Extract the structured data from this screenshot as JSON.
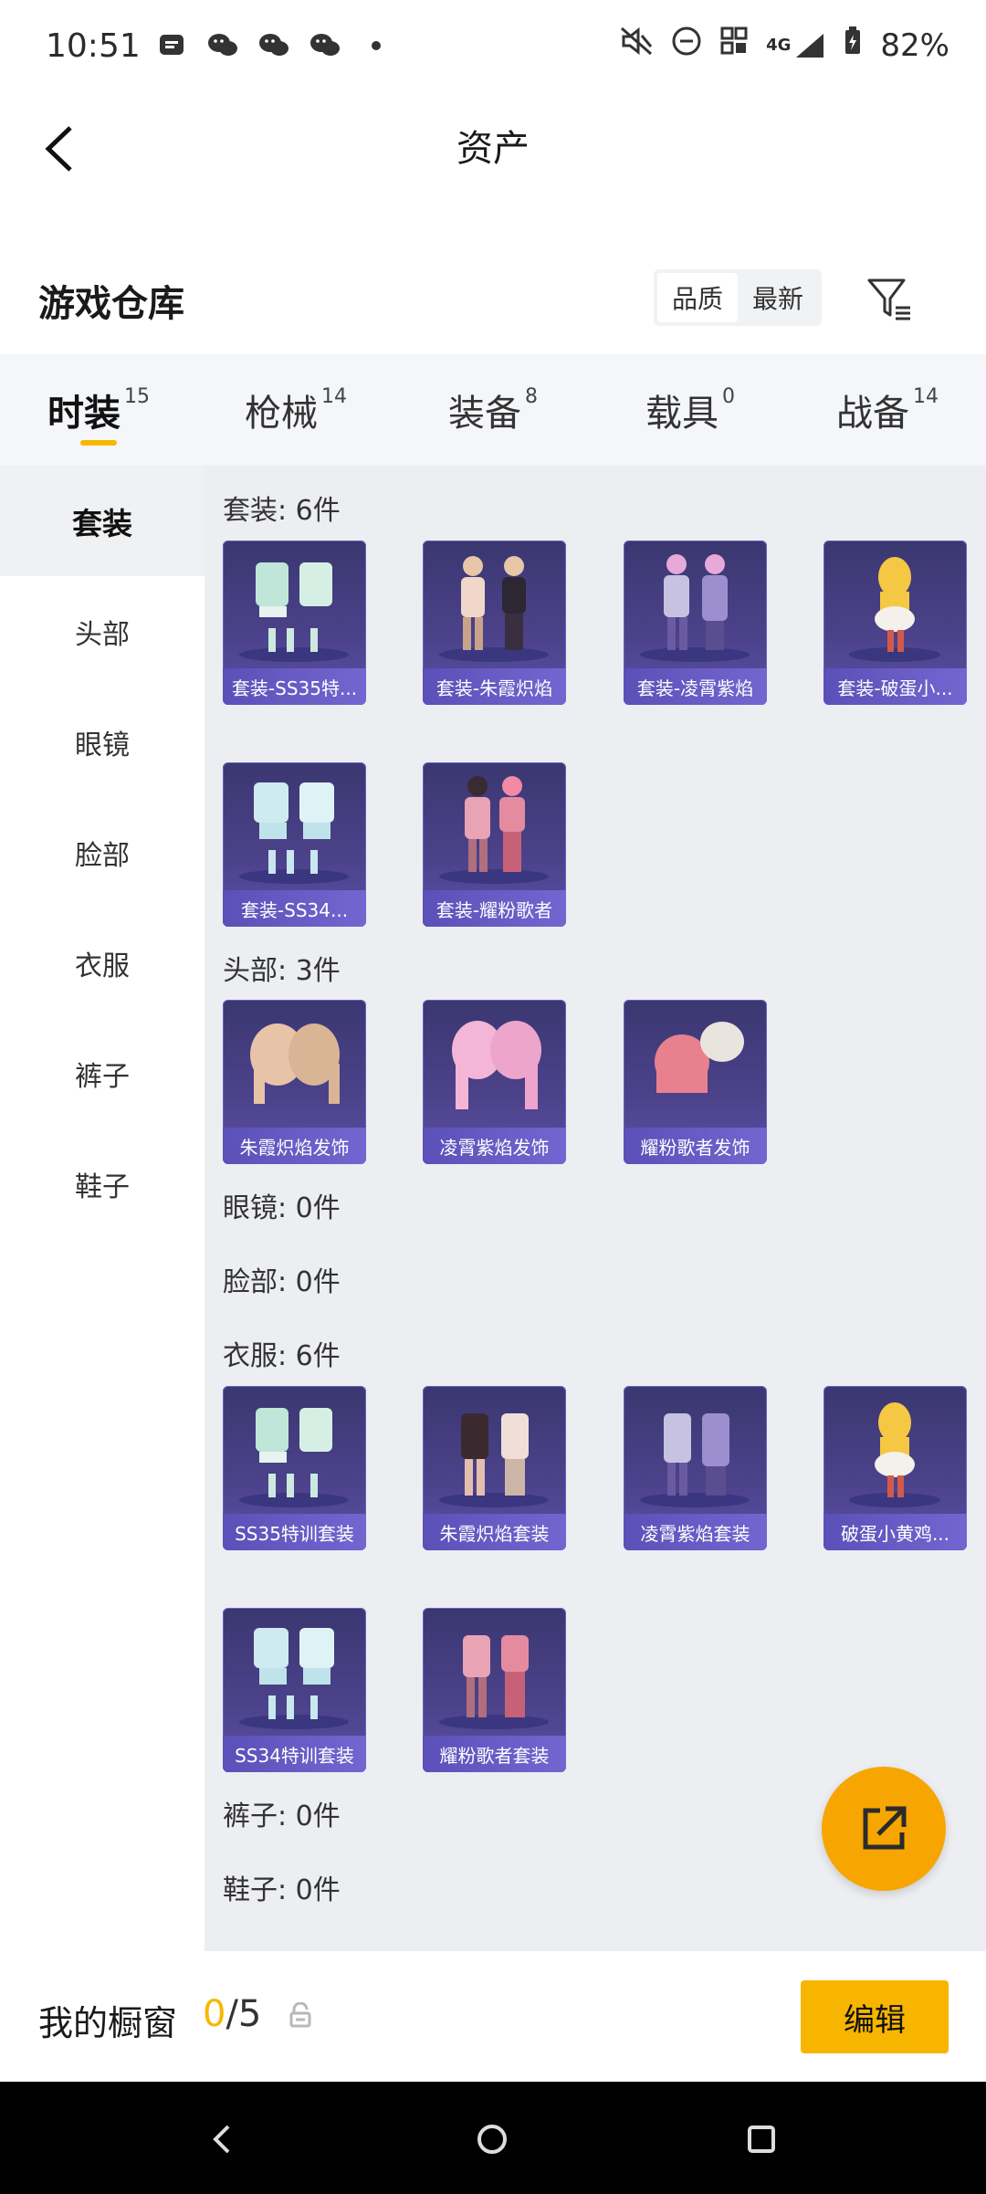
{
  "status_bar": {
    "time": "10:51",
    "network": "4G",
    "battery": "82%"
  },
  "header": {
    "title": "资产"
  },
  "warehouse": {
    "title": "游戏仓库",
    "sort_options": [
      "品质",
      "最新"
    ],
    "active_sort": "品质"
  },
  "tabs": [
    {
      "label": "时装",
      "count": "15",
      "active": true
    },
    {
      "label": "枪械",
      "count": "14",
      "active": false
    },
    {
      "label": "装备",
      "count": "8",
      "active": false
    },
    {
      "label": "载具",
      "count": "0",
      "active": false
    },
    {
      "label": "战备",
      "count": "14",
      "active": false
    }
  ],
  "sidebar": [
    {
      "label": "套装",
      "active": true
    },
    {
      "label": "头部",
      "active": false
    },
    {
      "label": "眼镜",
      "active": false
    },
    {
      "label": "脸部",
      "active": false
    },
    {
      "label": "衣服",
      "active": false
    },
    {
      "label": "裤子",
      "active": false
    },
    {
      "label": "鞋子",
      "active": false
    }
  ],
  "sections": {
    "suits": {
      "title": "套装: 6件",
      "items": [
        "套装-SS35特...",
        "套装-朱霞炽焰",
        "套装-凌霄紫焰",
        "套装-破蛋小...",
        "套装-SS34...",
        "套装-耀粉歌者"
      ]
    },
    "head": {
      "title": "头部: 3件",
      "items": [
        "朱霞炽焰发饰",
        "凌霄紫焰发饰",
        "耀粉歌者发饰"
      ]
    },
    "glasses": {
      "title": "眼镜: 0件"
    },
    "face": {
      "title": "脸部: 0件"
    },
    "clothes": {
      "title": "衣服: 6件",
      "items": [
        "SS35特训套装",
        "朱霞炽焰套装",
        "凌霄紫焰套装",
        "破蛋小黄鸡...",
        "SS34特训套装",
        "耀粉歌者套装"
      ]
    },
    "pants": {
      "title": "裤子: 0件"
    },
    "shoes": {
      "title": "鞋子: 0件"
    }
  },
  "footer": {
    "label": "我的橱窗",
    "current": "0",
    "total": "/5",
    "edit_label": "编辑"
  },
  "colors": {
    "accent": "#f7b500",
    "item_bg": "#4b4189",
    "item_label": "#6b5fc8"
  }
}
